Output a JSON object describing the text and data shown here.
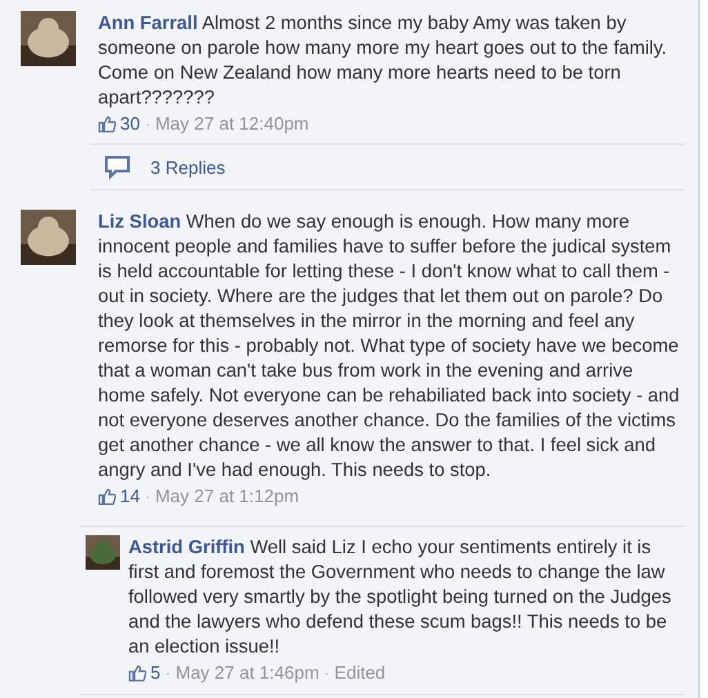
{
  "comments": [
    {
      "author": "Ann Farrall",
      "text": "Almost 2 months since my baby Amy was taken by someone on parole how many more my heart goes out to the family. Come on New Zealand how many more hearts need to be torn apart???????",
      "likes": "30",
      "meta": [
        {
          "sep": "·",
          "text": "May 27 at 12:40pm"
        }
      ],
      "replies_link": "3 Replies"
    },
    {
      "author": "Liz Sloan",
      "text": "When do we say enough is enough. How many more innocent people and families have to suffer before the judical system is held accountable for letting these - I don't know what to call them - out in society. Where are the judges that let them out on parole? Do they look at themselves in the mirror in the morning and feel any remorse for this - probably not. What type of society have we become that a woman can't take bus from work in the evening and arrive home safely. Not everyone can be rehabiliated back into society - and not everyone deserves another chance. Do the families of the victims get another chance - we all know the answer to that. I feel sick and angry and I've had enough. This needs to stop.",
      "likes": "14",
      "meta": [
        {
          "sep": "·",
          "text": "May 27 at 1:12pm"
        }
      ],
      "replies": [
        {
          "author": "Astrid Griffin",
          "text": "Well said Liz I echo your sentiments entirely it is first and foremost the Government who needs to change the law followed very smartly by the spotlight being turned on the Judges and the lawyers who defend these scum bags!! This needs to be an election issue!!",
          "likes": "5",
          "meta": [
            {
              "sep": "·",
              "text": "May 27 at 1:46pm"
            },
            {
              "sep": "·",
              "text": "Edited"
            }
          ]
        }
      ]
    }
  ]
}
